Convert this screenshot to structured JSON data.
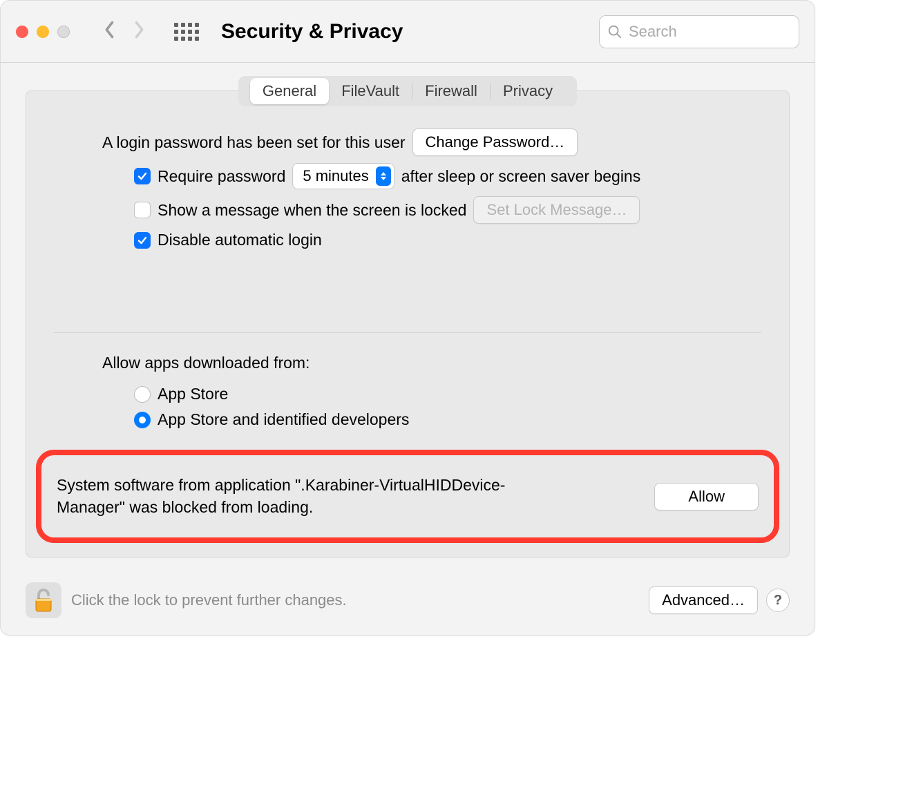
{
  "toolbar": {
    "title": "Security & Privacy",
    "search_placeholder": "Search"
  },
  "tabs": {
    "general": "General",
    "filevault": "FileVault",
    "firewall": "Firewall",
    "privacy": "Privacy"
  },
  "login": {
    "password_set": "A login password has been set for this user",
    "change_password": "Change Password…",
    "require_password": "Require password",
    "delay_value": "5 minutes",
    "after_sleep": "after sleep or screen saver begins",
    "show_message": "Show a message when the screen is locked",
    "set_lock_message": "Set Lock Message…",
    "disable_auto_login": "Disable automatic login"
  },
  "gatekeeper": {
    "allow_label": "Allow apps downloaded from:",
    "app_store": "App Store",
    "identified": "App Store and identified developers",
    "blocked_message": "System software from application \".Karabiner-VirtualHIDDevice-Manager\" was blocked from loading.",
    "allow_button": "Allow"
  },
  "footer": {
    "lock_text": "Click the lock to prevent further changes.",
    "advanced": "Advanced…",
    "help": "?"
  }
}
